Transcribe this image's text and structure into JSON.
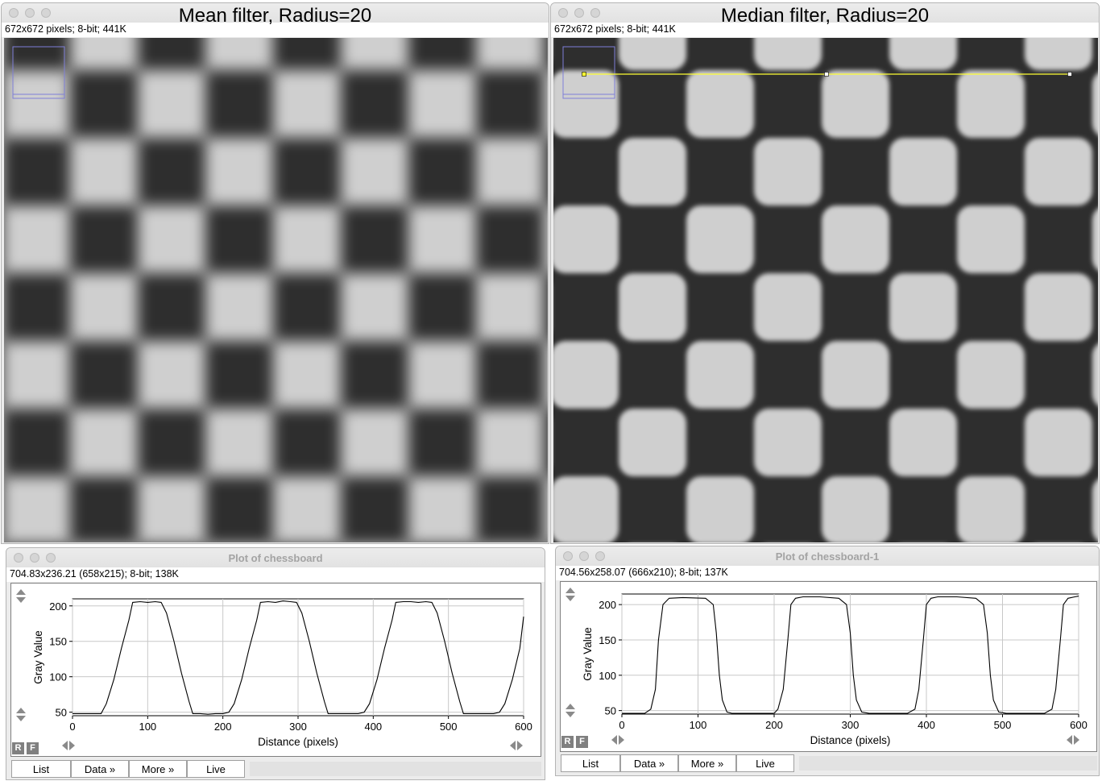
{
  "left_image": {
    "title": "Mean filter, Radius=20",
    "info": "672x672 pixels; 8-bit; 441K"
  },
  "right_image": {
    "title": "Median filter, Radius=20",
    "info": "672x672 pixels; 8-bit; 441K"
  },
  "left_plot": {
    "window_title": "Plot of chessboard",
    "info": "704.83x236.21   (658x215); 8-bit; 138K",
    "buttons": [
      "List",
      "Data »",
      "More »",
      "Live"
    ],
    "r_label": "R",
    "f_label": "F"
  },
  "right_plot": {
    "window_title": "Plot of chessboard-1",
    "info": "704.56x258.07   (666x210); 8-bit; 137K",
    "buttons": [
      "List",
      "Data »",
      "More »",
      "Live"
    ],
    "r_label": "R",
    "f_label": "F"
  },
  "chart_data": [
    {
      "type": "line",
      "xlabel": "Distance (pixels)",
      "ylabel": "Gray Value",
      "xlim": [
        0,
        600
      ],
      "ylim": [
        45,
        210
      ],
      "xticks": [
        0,
        100,
        200,
        300,
        400,
        500,
        600
      ],
      "yticks": [
        50,
        100,
        150,
        200
      ],
      "grid": true,
      "series": [
        {
          "x": [
            0,
            38,
            45,
            55,
            65,
            75,
            80,
            90,
            100,
            110,
            118,
            125,
            135,
            145,
            155,
            160,
            170,
            180,
            190,
            200,
            208,
            215,
            225,
            235,
            245,
            250,
            260,
            270,
            280,
            290,
            298,
            305,
            315,
            325,
            335,
            340,
            350,
            360,
            370,
            380,
            388,
            395,
            405,
            415,
            425,
            430,
            440,
            450,
            460,
            470,
            478,
            485,
            495,
            505,
            515,
            520,
            530,
            540,
            550,
            560,
            568,
            575,
            585,
            595,
            600
          ],
          "y": [
            48,
            48,
            62,
            96,
            140,
            180,
            205,
            206,
            205,
            206,
            205,
            190,
            150,
            105,
            65,
            48,
            48,
            47,
            48,
            48,
            50,
            62,
            96,
            140,
            180,
            205,
            206,
            205,
            207,
            206,
            205,
            190,
            150,
            105,
            65,
            48,
            48,
            48,
            48,
            48,
            50,
            62,
            96,
            140,
            180,
            205,
            206,
            206,
            205,
            206,
            205,
            190,
            150,
            105,
            65,
            48,
            48,
            48,
            48,
            48,
            50,
            62,
            96,
            140,
            185
          ]
        }
      ]
    },
    {
      "type": "line",
      "xlabel": "Distance (pixels)",
      "ylabel": "Gray Value",
      "xlim": [
        0,
        600
      ],
      "ylim": [
        45,
        215
      ],
      "xticks": [
        0,
        100,
        200,
        300,
        400,
        500,
        600
      ],
      "yticks": [
        50,
        100,
        150,
        200
      ],
      "grid": true,
      "series": [
        {
          "x": [
            0,
            30,
            38,
            44,
            48,
            54,
            62,
            80,
            110,
            120,
            124,
            128,
            132,
            138,
            145,
            160,
            180,
            200,
            205,
            212,
            218,
            222,
            228,
            238,
            260,
            285,
            295,
            300,
            304,
            308,
            315,
            325,
            350,
            375,
            385,
            390,
            396,
            400,
            406,
            415,
            440,
            465,
            475,
            480,
            484,
            488,
            495,
            505,
            530,
            555,
            565,
            570,
            576,
            580,
            586,
            595,
            600
          ],
          "y": [
            46,
            46,
            52,
            80,
            150,
            200,
            209,
            210,
            209,
            200,
            160,
            100,
            65,
            48,
            46,
            46,
            46,
            46,
            52,
            80,
            150,
            200,
            209,
            211,
            211,
            209,
            200,
            160,
            100,
            65,
            48,
            46,
            46,
            46,
            52,
            80,
            150,
            200,
            209,
            211,
            211,
            209,
            200,
            160,
            100,
            65,
            48,
            46,
            46,
            46,
            52,
            80,
            150,
            200,
            209,
            211,
            212
          ]
        }
      ]
    }
  ]
}
